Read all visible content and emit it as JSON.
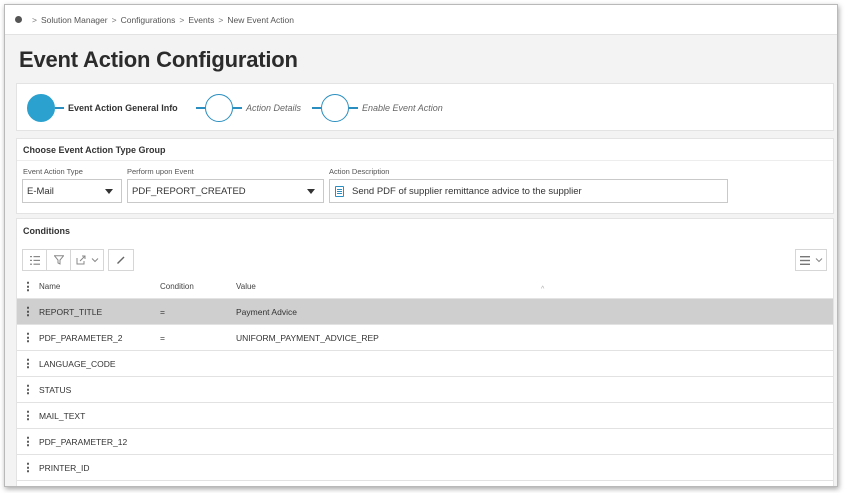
{
  "breadcrumb": {
    "items": [
      "Solution Manager",
      "Configurations",
      "Events",
      "New Event Action"
    ]
  },
  "page_title": "Event Action Configuration",
  "wizard": {
    "steps": [
      {
        "label": "Event Action General Info",
        "state": "active"
      },
      {
        "label": "Action Details",
        "state": "pending"
      },
      {
        "label": "Enable Event Action",
        "state": "pending"
      }
    ]
  },
  "type_group": {
    "header": "Choose Event Action Type Group",
    "event_action_type_label": "Event Action Type",
    "event_action_type_value": "E-Mail",
    "perform_upon_label": "Perform upon Event",
    "perform_upon_value": "PDF_REPORT_CREATED",
    "description_label": "Action Description",
    "description_value": "Send PDF of supplier remittance advice to the supplier"
  },
  "conditions": {
    "header": "Conditions",
    "columns": {
      "name": "Name",
      "condition": "Condition",
      "value": "Value"
    },
    "rows": [
      {
        "name": "REPORT_TITLE",
        "condition": "=",
        "value": "Payment Advice",
        "selected": true
      },
      {
        "name": "PDF_PARAMETER_2",
        "condition": "=",
        "value": "UNIFORM_PAYMENT_ADVICE_REP",
        "selected": false
      },
      {
        "name": "LANGUAGE_CODE",
        "condition": "",
        "value": "",
        "selected": false
      },
      {
        "name": "STATUS",
        "condition": "",
        "value": "",
        "selected": false
      },
      {
        "name": "MAIL_TEXT",
        "condition": "",
        "value": "",
        "selected": false
      },
      {
        "name": "PDF_PARAMETER_12",
        "condition": "",
        "value": "",
        "selected": false
      },
      {
        "name": "PRINTER_ID",
        "condition": "",
        "value": "",
        "selected": false
      }
    ]
  },
  "colors": {
    "accent": "#2aa1cf",
    "selected_row": "#cfcfcf"
  }
}
